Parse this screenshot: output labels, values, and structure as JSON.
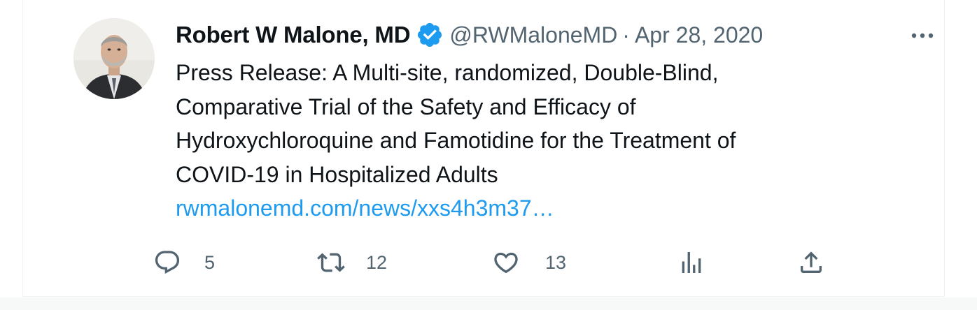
{
  "tweet": {
    "author": {
      "display_name": "Robert W Malone, MD",
      "verified": true,
      "handle": "@RWMaloneMD",
      "separator": "·",
      "date": "Apr 28, 2020",
      "avatar_icon": "profile-photo"
    },
    "body_lines": [
      "Press Release: A Multi-site, randomized, Double-Blind,",
      "Comparative Trial of the Safety and Efficacy of",
      "Hydroxychloroquine and Famotidine for the Treatment of",
      "COVID-19 in Hospitalized Adults"
    ],
    "link_text": "rwmalonemd.com/news/xxs4h3m37…",
    "actions": {
      "reply": {
        "icon": "reply-icon",
        "count": "5"
      },
      "retweet": {
        "icon": "retweet-icon",
        "count": "12"
      },
      "like": {
        "icon": "heart-icon",
        "count": "13"
      },
      "views": {
        "icon": "analytics-icon"
      },
      "share": {
        "icon": "share-icon"
      }
    },
    "more_icon": "more-options-icon"
  },
  "colors": {
    "text_primary": "#0f1419",
    "text_secondary": "#536471",
    "link": "#1d9bf0",
    "verified": "#1d9bf0",
    "border": "#eff3f4"
  }
}
